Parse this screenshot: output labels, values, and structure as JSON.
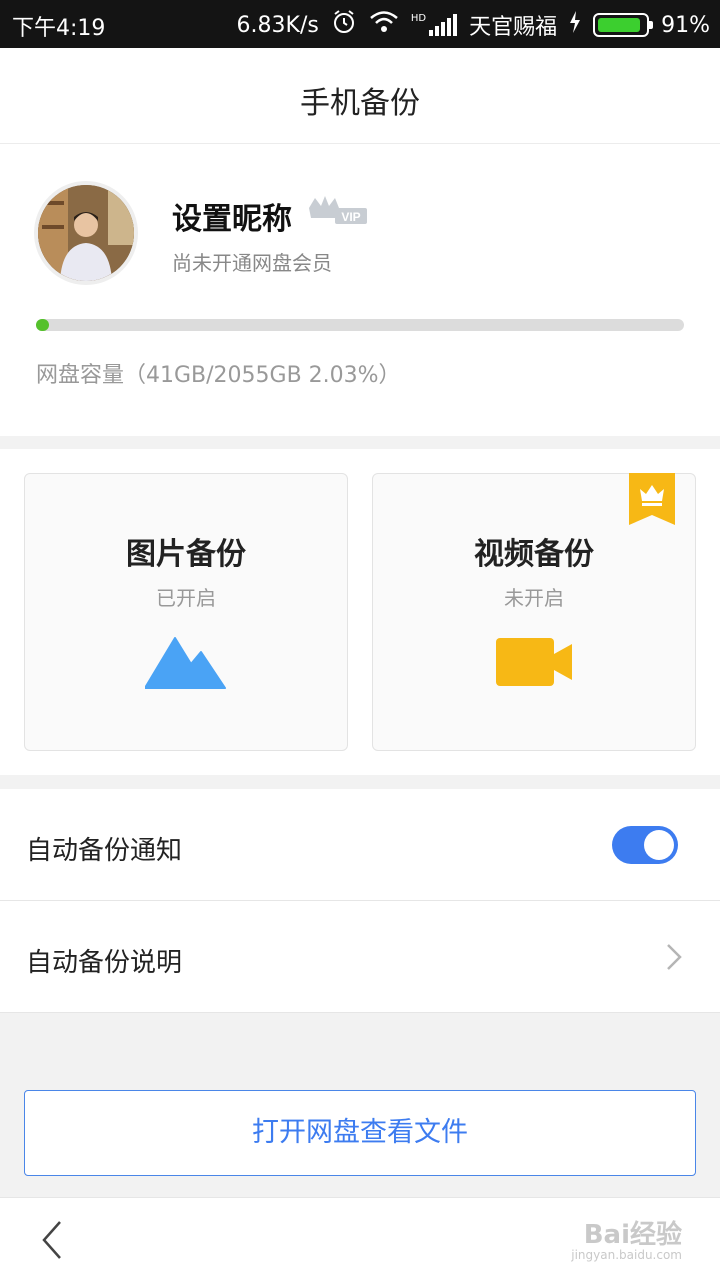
{
  "status_bar": {
    "time": "下午4:19",
    "net_speed": "6.83K/s",
    "carrier": "天官赐福",
    "battery": "91%",
    "battery_level": 0.91,
    "icons": [
      "alarm-icon",
      "wifi-icon",
      "hd-signal-icon",
      "charging-icon",
      "battery-icon"
    ]
  },
  "header": {
    "title": "手机备份"
  },
  "profile": {
    "nickname": "设置昵称",
    "vip_badge": "VIP",
    "membership": "尚未开通网盘会员",
    "capacity_text": "网盘容量（41GB/2055GB 2.03%）",
    "usage_fraction": 0.0203
  },
  "cards": {
    "photo": {
      "title": "图片备份",
      "status": "已开启",
      "icon": "mountain-icon"
    },
    "video": {
      "title": "视频备份",
      "status": "未开启",
      "icon": "video-camera-icon",
      "badge_icon": "crown-ribbon-icon"
    }
  },
  "settings": {
    "auto_notify_label": "自动备份通知",
    "auto_notify_on": true,
    "auto_desc_label": "自动备份说明"
  },
  "open_button": "打开网盘查看文件",
  "watermark": {
    "main": "Bai经验",
    "sub": "jingyan.baidu.com"
  },
  "colors": {
    "accent": "#3d7cf0",
    "progress": "#55c12c",
    "gold": "#f7b815",
    "photo_blue": "#4aa3f5"
  }
}
